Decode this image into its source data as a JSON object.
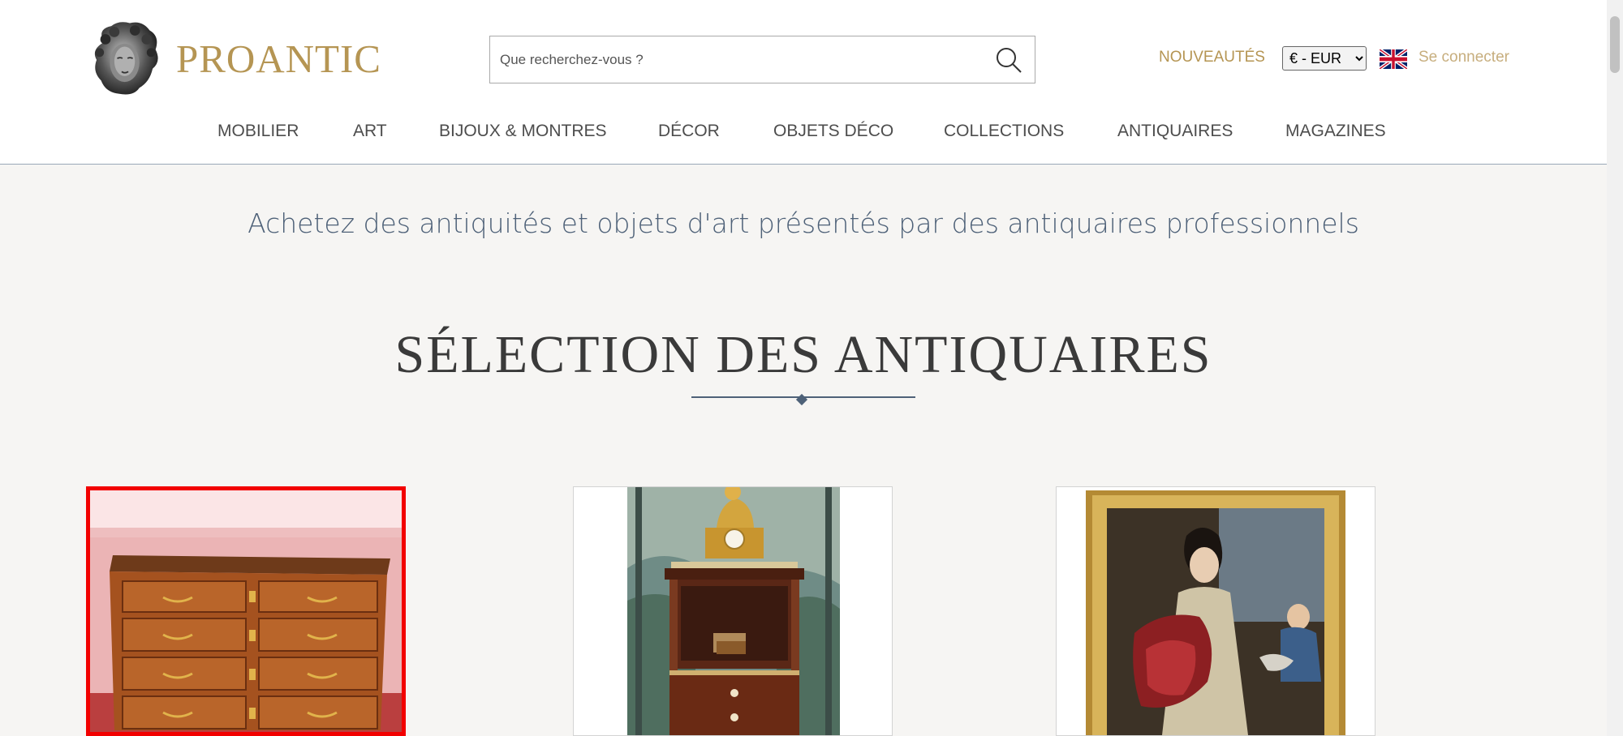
{
  "header": {
    "brand_name": "PROANTIC",
    "search": {
      "placeholder": "Que recherchez-vous ?"
    },
    "nouveautes_label": "NOUVEAUTÉS",
    "currency": {
      "selected": "€ - EUR"
    },
    "login_label": "Se connecter"
  },
  "nav": {
    "items": [
      {
        "label": "MOBILIER"
      },
      {
        "label": "ART"
      },
      {
        "label": "BIJOUX & MONTRES"
      },
      {
        "label": "DÉCOR"
      },
      {
        "label": "OBJETS DÉCO"
      },
      {
        "label": "COLLECTIONS"
      },
      {
        "label": "ANTIQUAIRES"
      },
      {
        "label": "MAGAZINES"
      }
    ]
  },
  "main": {
    "tagline": "Achetez des antiquités et objets d'art présentés par des antiquaires professionnels",
    "section_title": "SÉLECTION DES ANTIQUAIRES",
    "cards": [
      {
        "icon": "commode-image",
        "selected": true
      },
      {
        "icon": "clock-cabinet-image",
        "selected": false
      },
      {
        "icon": "portrait-painting-image",
        "selected": false
      }
    ]
  },
  "colors": {
    "brand_gold": "#b59553",
    "login_gold": "#c7ae7e",
    "tagline_blue": "#4e6178",
    "selection_red": "#f20000",
    "background": "#f6f5f3"
  }
}
